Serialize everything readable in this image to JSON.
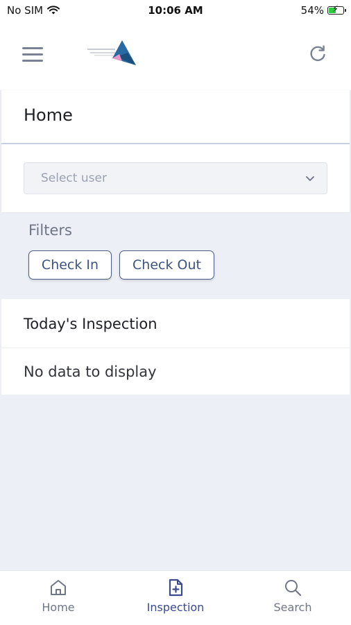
{
  "status_bar": {
    "carrier": "No SIM",
    "time": "10:06 AM",
    "battery": "54%",
    "battery_level": 0.54
  },
  "header": {
    "menu_icon": "hamburger-menu-icon",
    "refresh_icon": "refresh-icon"
  },
  "home": {
    "title": "Home",
    "select_user": {
      "placeholder": "Select user"
    }
  },
  "filters": {
    "label": "Filters",
    "options": [
      "Check In",
      "Check Out"
    ]
  },
  "inspection": {
    "title": "Today's Inspection",
    "empty_text": "No data to display"
  },
  "tabs": [
    {
      "label": "Home",
      "icon": "home-icon",
      "active": false
    },
    {
      "label": "Inspection",
      "icon": "inspection-document-icon",
      "active": true
    },
    {
      "label": "Search",
      "icon": "search-icon",
      "active": false
    }
  ],
  "colors": {
    "accent": "#3b4a8f",
    "background": "#ecf0f6",
    "chip_border": "#4a5d80",
    "battery_fill": "#2ecc40"
  }
}
